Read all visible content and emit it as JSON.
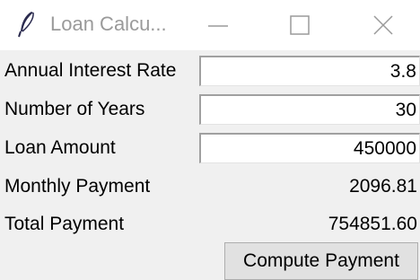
{
  "window": {
    "title": "Loan Calcu..."
  },
  "form": {
    "interest_rate": {
      "label": "Annual Interest Rate",
      "value": "3.8"
    },
    "years": {
      "label": "Number of Years",
      "value": "30"
    },
    "loan_amount": {
      "label": "Loan Amount",
      "value": "450000"
    },
    "monthly_payment": {
      "label": "Monthly Payment",
      "value": "2096.81"
    },
    "total_payment": {
      "label": "Total Payment",
      "value": "754851.60"
    }
  },
  "actions": {
    "compute_label": "Compute Payment"
  },
  "icons": {
    "app": "feather-icon",
    "minimize": "minimize-icon",
    "maximize": "maximize-icon",
    "close": "close-icon"
  },
  "colors": {
    "window_bg": "#f0f0f0",
    "titlebar_bg": "#ffffff",
    "title_text": "#9a9a9a",
    "button_bg": "#e1e1e1"
  }
}
